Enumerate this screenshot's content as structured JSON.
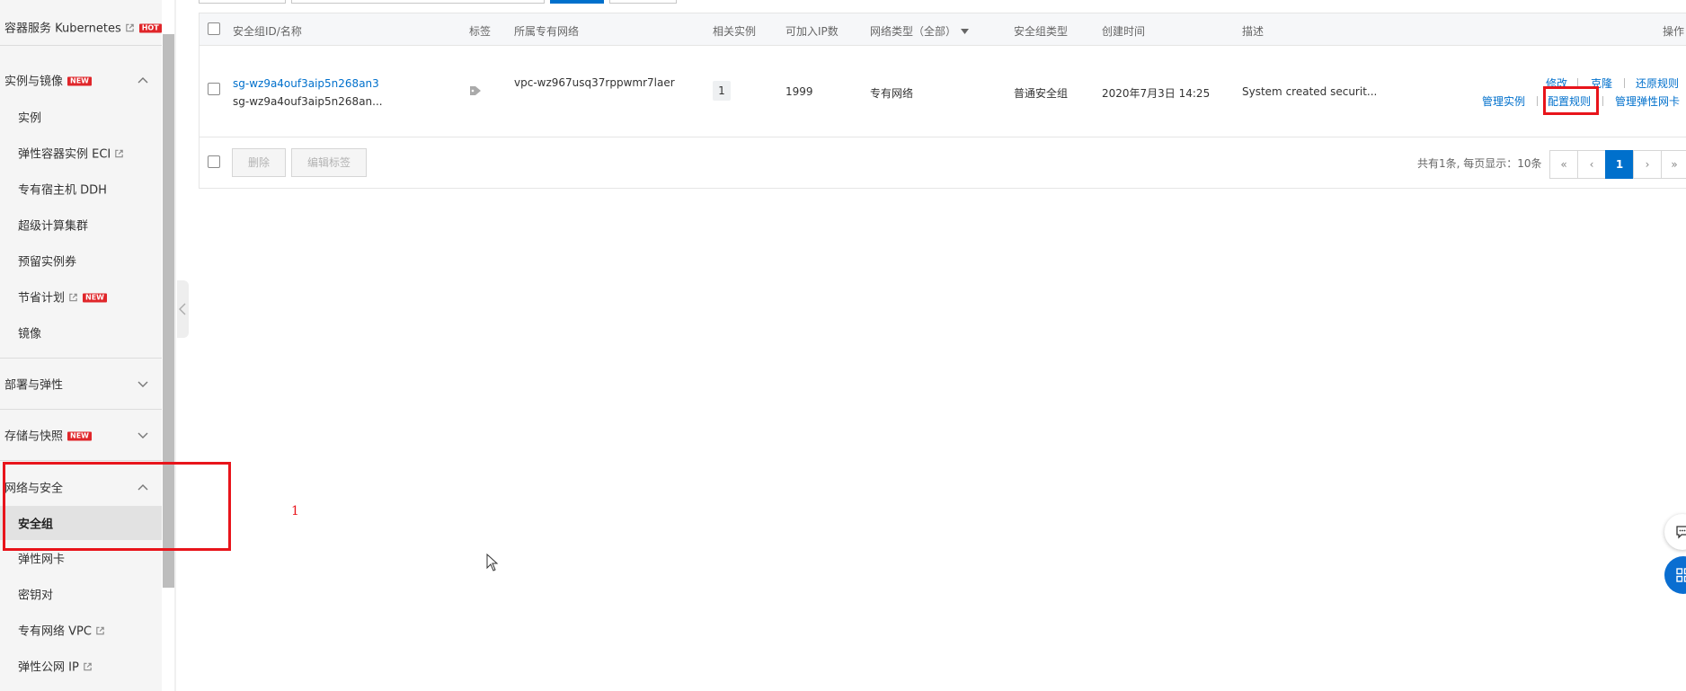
{
  "sidebar": {
    "items": [
      {
        "label": "容器服务 Kubernetes",
        "external": true,
        "badge": "HOT",
        "type": "sub-top"
      },
      {
        "label": "实例与镜像",
        "badge": "NEW",
        "type": "group",
        "expanded": true
      },
      {
        "label": "实例",
        "type": "sub"
      },
      {
        "label": "弹性容器实例 ECI",
        "external": true,
        "type": "sub"
      },
      {
        "label": "专有宿主机 DDH",
        "type": "sub"
      },
      {
        "label": "超级计算集群",
        "type": "sub"
      },
      {
        "label": "预留实例券",
        "type": "sub"
      },
      {
        "label": "节省计划",
        "external": true,
        "badge": "NEW",
        "type": "sub"
      },
      {
        "label": "镜像",
        "type": "sub"
      },
      {
        "label": "部署与弹性",
        "type": "group",
        "expanded": false
      },
      {
        "label": "存储与快照",
        "badge": "NEW",
        "type": "group",
        "expanded": false
      },
      {
        "label": "网络与安全",
        "type": "group",
        "expanded": true
      },
      {
        "label": "安全组",
        "type": "sub",
        "active": true
      },
      {
        "label": "弹性网卡",
        "type": "sub"
      },
      {
        "label": "密钥对",
        "type": "sub"
      },
      {
        "label": "专有网络 VPC",
        "external": true,
        "type": "sub"
      },
      {
        "label": "弹性公网 IP",
        "external": true,
        "type": "sub"
      }
    ]
  },
  "table": {
    "headers": {
      "id_name": "安全组ID/名称",
      "tags": "标签",
      "vpc": "所属专有网络",
      "instances": "相关实例",
      "ip_count": "可加入IP数",
      "network_type": "网络类型（全部）",
      "sg_type": "安全组类型",
      "created": "创建时间",
      "desc": "描述",
      "ops": "操作"
    },
    "rows": [
      {
        "id": "sg-wz9a4ouf3aip5n268an3",
        "name": "sg-wz9a4ouf3aip5n268an...",
        "vpc": "vpc-wz967usq37rppwmr7laer",
        "instances": "1",
        "ip_count": "1999",
        "network_type": "专有网络",
        "sg_type": "普通安全组",
        "created": "2020年7月3日 14:25",
        "desc": "System created securit...",
        "ops": {
          "edit": "修改",
          "clone": "克隆",
          "restore": "还原规则",
          "manage_instances": "管理实例",
          "config_rules": "配置规则",
          "manage_eni": "管理弹性网卡"
        }
      }
    ],
    "footer": {
      "delete": "删除",
      "edit_tags": "编辑标签",
      "summary": "共有1条, 每页显示：10条",
      "pager": {
        "first": "«",
        "prev": "‹",
        "current": "1",
        "next": "›",
        "last": "»"
      }
    }
  },
  "annotation": {
    "step": "1"
  },
  "colors": {
    "accent": "#0070cc",
    "highlight": "#e8141b",
    "badge": "#e0262a"
  }
}
